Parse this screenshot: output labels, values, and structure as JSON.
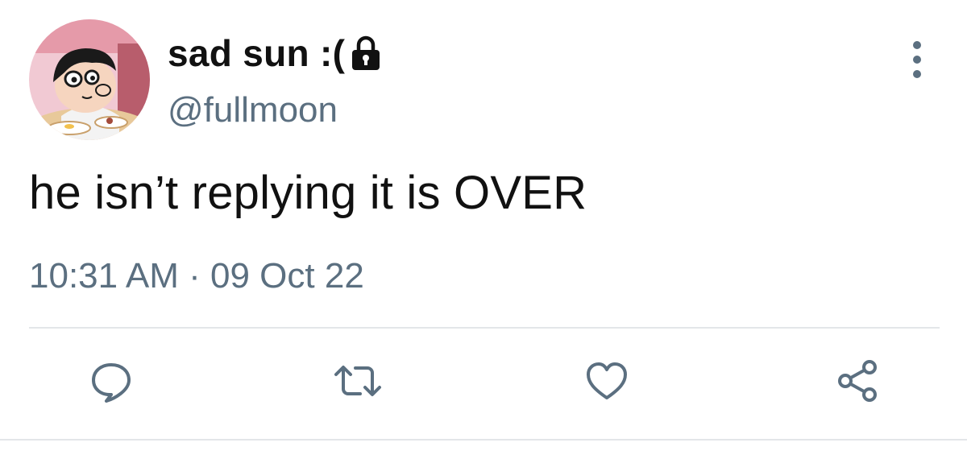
{
  "tweet": {
    "display_name": "sad sun :(",
    "handle": "@fullmoon",
    "text": "he isn’t replying it is OVER",
    "timestamp": "10:31 AM · 09 Oct 22",
    "protected_icon": "lock-icon",
    "menu_icon": "more-vertical-icon"
  },
  "actions": [
    {
      "name": "reply",
      "icon": "speech-bubble-icon"
    },
    {
      "name": "retweet",
      "icon": "retweet-icon"
    },
    {
      "name": "like",
      "icon": "heart-icon"
    },
    {
      "name": "share",
      "icon": "share-icon"
    }
  ],
  "colors": {
    "text_primary": "#111111",
    "text_secondary": "#5b6f80",
    "icon": "#5b6f80",
    "divider": "#e3e6e9"
  }
}
